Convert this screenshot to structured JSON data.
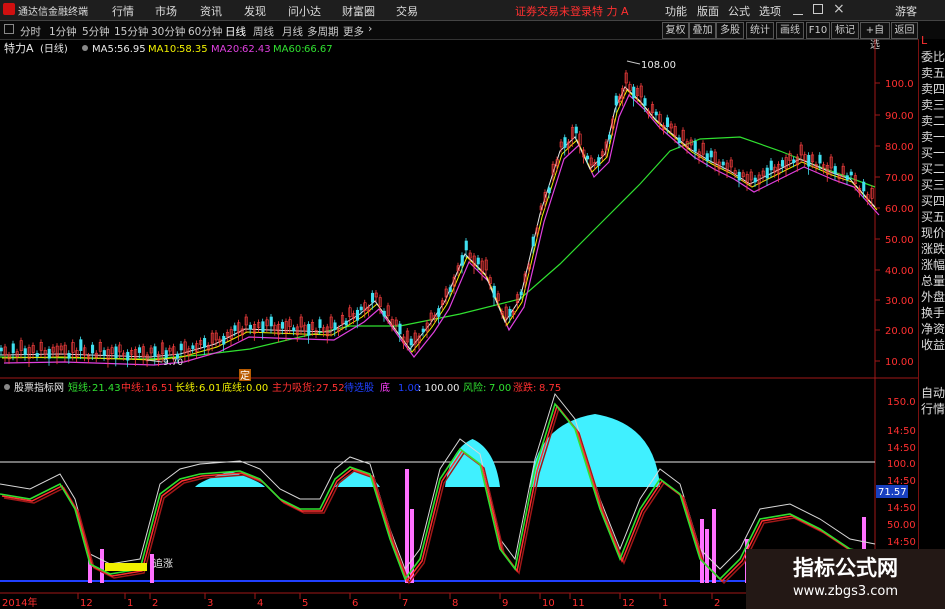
{
  "app": {
    "title": "通达信金融终端"
  },
  "menu": {
    "items": [
      "行情",
      "市场",
      "资讯",
      "发现",
      "问小达",
      "财富圈",
      "交易"
    ],
    "login_status": "证券交易未登录",
    "stock": "特 力 A",
    "right_items": [
      "功能",
      "版面",
      "公式",
      "选项"
    ],
    "guest": "游客"
  },
  "toolbar": {
    "periods": [
      "分时",
      "1分钟",
      "5分钟",
      "15分钟",
      "30分钟",
      "60分钟",
      "日线",
      "周线",
      "月线",
      "多周期",
      "更多"
    ],
    "active_period": "日线",
    "buttons": [
      "复权",
      "叠加",
      "多股",
      "统计",
      "画线",
      "F10",
      "标记",
      "+自选",
      "返回"
    ]
  },
  "price_chart": {
    "stock_name": "特力A",
    "period_tag": "(日线)",
    "ma": [
      {
        "label": "MA5:",
        "value": "56.95",
        "color": "#e8e8e8"
      },
      {
        "label": "MA10:",
        "value": "58.35",
        "color": "#f0f000"
      },
      {
        "label": "MA20:",
        "value": "62.43",
        "color": "#e040e0"
      },
      {
        "label": "MA60:",
        "value": "66.67",
        "color": "#30e030"
      }
    ],
    "y_axis": [
      "100.0",
      "90.00",
      "80.00",
      "70.00",
      "60.00",
      "50.00",
      "40.00",
      "30.00",
      "20.00",
      "10.00"
    ],
    "high_label": "108.00",
    "low_label": "9.70",
    "marker": "定"
  },
  "indicator": {
    "name": "股票指标网",
    "params": [
      {
        "label": "短线:",
        "value": "21.43",
        "color": "#30e030"
      },
      {
        "label": "中线:",
        "value": "16.51",
        "color": "#ff3030"
      },
      {
        "label": "长线:",
        "value": "6.01",
        "color": "#f0f000"
      },
      {
        "label": "底线:",
        "value": "0.00",
        "color": "#f0f000"
      },
      {
        "label": "主力吸货:",
        "value": "27.52",
        "color": "#ff3030"
      },
      {
        "label": "待选股",
        "value": "",
        "color": "#2040ff"
      },
      {
        "label": "底",
        "value": "",
        "color": "#ff40ff"
      },
      {
        "label": "",
        "value": "1.00",
        "color": "#2040ff"
      },
      {
        "label": "",
        "value": ": 100.00",
        "color": "#e8e8e8"
      },
      {
        "label": "风险:",
        "value": "7.00",
        "color": "#30e030"
      },
      {
        "label": "涨跌:",
        "value": "8.75",
        "color": "#ff3030"
      }
    ],
    "y_axis": [
      "150.0",
      "14:50",
      "14:50",
      "100.0",
      "14:50",
      "14:50",
      "50.00",
      "14:50"
    ],
    "current": "71.57",
    "annotation": "追涨"
  },
  "x_axis": {
    "year": "2014年",
    "months": [
      "12",
      "1",
      "2",
      "3",
      "4",
      "5",
      "6",
      "7",
      "8",
      "9",
      "10",
      "11",
      "12",
      "1",
      "2",
      "3"
    ]
  },
  "right_panel": {
    "top": "L",
    "labels": [
      "委比",
      "卖五",
      "卖四",
      "卖三",
      "卖二",
      "卖一",
      "买一",
      "买二",
      "买三",
      "买四",
      "买五",
      "现价",
      "涨跌",
      "涨幅",
      "总量",
      "外盘",
      "换手",
      "净资",
      "收益",
      "自动",
      "行情"
    ]
  },
  "watermark": {
    "title": "指标公式网",
    "url": "www.zbgs3.com"
  },
  "colors": {
    "accent_red": "#ff3030",
    "axis_red": "#a01818",
    "ma5": "#e8e8e8",
    "ma10": "#f0f000",
    "ma20": "#e040e0",
    "ma60": "#30e030",
    "area_cyan": "#40f0ff",
    "volume_pink": "#ff70ff"
  }
}
